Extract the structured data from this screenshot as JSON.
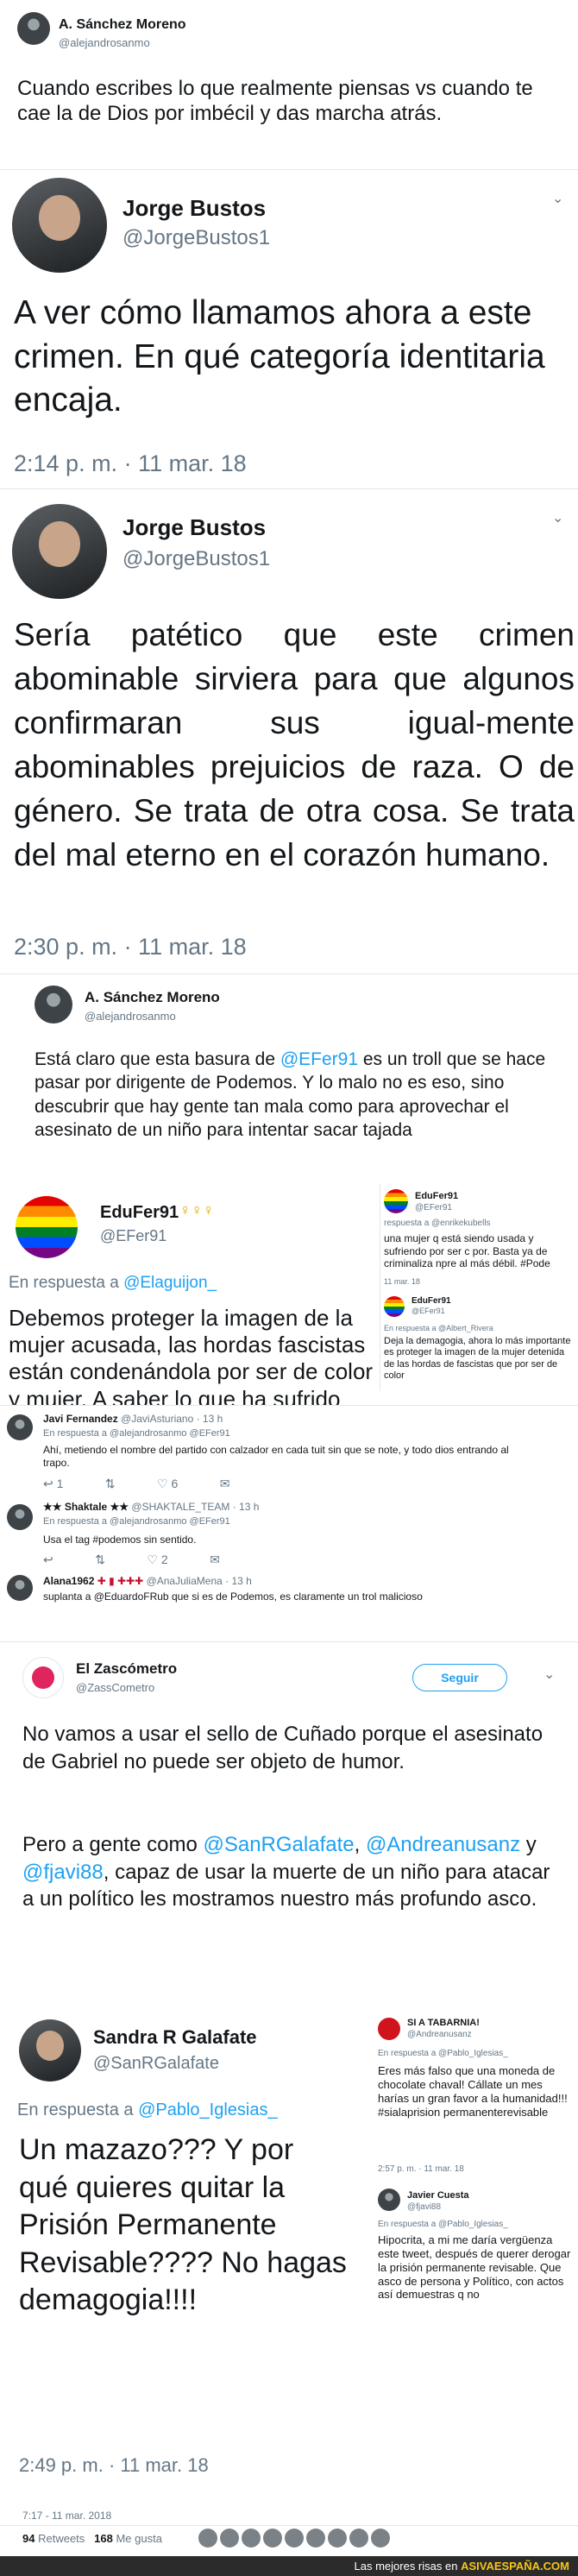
{
  "tweet1": {
    "name": "A. Sánchez Moreno",
    "handle": "@alejandrosanmo",
    "text": "Cuando escribes lo que realmente piensas vs cuando te cae la de Dios por imbécil y das marcha atrás."
  },
  "tweet2": {
    "name": "Jorge Bustos",
    "handle": "@JorgeBustos1",
    "text": "A ver cómo llamamos ahora a este crimen. En qué categoría identitaria encaja.",
    "time": "2:14 p. m. · 11 mar. 18"
  },
  "tweet3": {
    "name": "Jorge Bustos",
    "handle": "@JorgeBustos1",
    "text": "Sería patético que este crimen abominable sirviera para que algunos confirmaran sus igual-mente abominables prejuicios de raza. O de género. Se trata de otra cosa. Se trata del mal eterno en el corazón humano.",
    "time": "2:30 p. m. · 11 mar. 18"
  },
  "tweet4": {
    "name": "A. Sánchez Moreno",
    "handle": "@alejandrosanmo",
    "text_before": "Está claro que esta basura de ",
    "mention": "@EFer91",
    "text_after": " es un troll que se hace pasar por dirigente de Podemos. Y lo malo no es eso, sino descubrir que hay gente tan mala como para aprovechar el asesinato de un niño para intentar sacar tajada"
  },
  "quoted_left": {
    "name": "EduFer91",
    "handle": "@EFer91",
    "reply_to_label": "En respuesta a ",
    "reply_to": "@Elaguijon_",
    "text": "Debemos proteger la imagen de la mujer acusada, las hordas fascistas están condenándola por ser de color y mujer. A saber lo que ha sufrido esa mujer para actuar así. #Podemos"
  },
  "quoted_right_top": {
    "name": "EduFer91",
    "handle": "@EFer91",
    "reply_line": "respuesta a @enrikekubells",
    "text": "una mujer q está siendo usada y sufriendo por ser c por. Basta ya de criminaliza npre al más débil. #Pode",
    "time": "11 mar. 18"
  },
  "quoted_right_bottom": {
    "name": "EduFer91",
    "handle": "@EFer91",
    "reply_line": "En respuesta a @Albert_Rivera",
    "text": "Deja la demagogia, ahora lo más importante es proteger la imagen de la mujer detenida de las hordas de fascistas que por ser de color"
  },
  "replies": [
    {
      "name": "Javi Fernandez",
      "handle": "@JaviAsturiano · 13 h",
      "reply_line": "En respuesta a @alejandrosanmo @EFer91",
      "text": "Ahí, metiendo el nombre del partido con calzador en cada tuit sin que se note, y todo dios entrando al trapo.",
      "replies": "1",
      "retweets": "",
      "likes": "6"
    },
    {
      "name": "Shaktale",
      "stars": "★★ Shaktale ★★",
      "handle": "@SHAKTALE_TEAM · 13 h",
      "reply_line": "En respuesta a @alejandrosanmo @EFer91",
      "text": "Usa el tag #podemos sin sentido.",
      "replies": "",
      "retweets": "",
      "likes": "2"
    },
    {
      "name": "Alana1962",
      "handle": "@AnaJuliaMena · 13 h",
      "text": "suplanta a @EduardoFRub que si es de Podemos, es claramente un trol malicioso"
    }
  ],
  "tweet5": {
    "name": "El Zascómetro",
    "handle": "@ZassCometro",
    "follow_label": "Seguir",
    "text1": "No vamos a usar el sello de Cuñado porque el asesinato de Gabriel no puede ser objeto de humor.",
    "text2_before": "Pero a gente como ",
    "mention1": "@SanRGalafate",
    "sep1": ", ",
    "mention2": "@Andreanusanz",
    "sep2": " y ",
    "mention3": "@fjavi88",
    "text2_after": ", capaz de usar la muerte de un niño para atacar a un político les mostramos nuestro más profundo asco."
  },
  "quoted_sandra": {
    "name": "Sandra R Galafate",
    "handle": "@SanRGalafate",
    "reply_to_label": "En respuesta a ",
    "reply_to": "@Pablo_Iglesias_",
    "text": "Un mazazo??? Y por qué quieres quitar la Prisión Permanente Revisable???? No hagas demagogia!!!!",
    "time": "2:49 p. m. · 11 mar. 18"
  },
  "quoted_andrea": {
    "name": "SI A TABARNIA!",
    "handle": "@Andreanusanz",
    "reply_line": "En respuesta a @Pablo_Iglesias_",
    "text": "Eres más falso que una moneda de chocolate chaval! Cállate un mes harías un gran favor a la humanidad!!! #sialaprision permanenterevisable",
    "time": "2:57 p. m. · 11 mar. 18"
  },
  "quoted_javier": {
    "name": "Javier Cuesta",
    "handle": "@fjavi88",
    "reply_line": "En respuesta a @Pablo_Iglesias_",
    "text": "Hipocrita, a mi me daría vergüenza este tweet, después de querer derogar la prisión permanente revisable. Que asco de persona y Político, con actos así demuestras q no"
  },
  "final_time": "7:17 - 11 mar. 2018",
  "stats": {
    "retweets_count": "94",
    "retweets_label": "Retweets",
    "likes_count": "168",
    "likes_label": "Me gusta"
  },
  "footer": {
    "text": "Las mejores risas en ",
    "brand": "ASIVAESPAÑA.COM"
  }
}
